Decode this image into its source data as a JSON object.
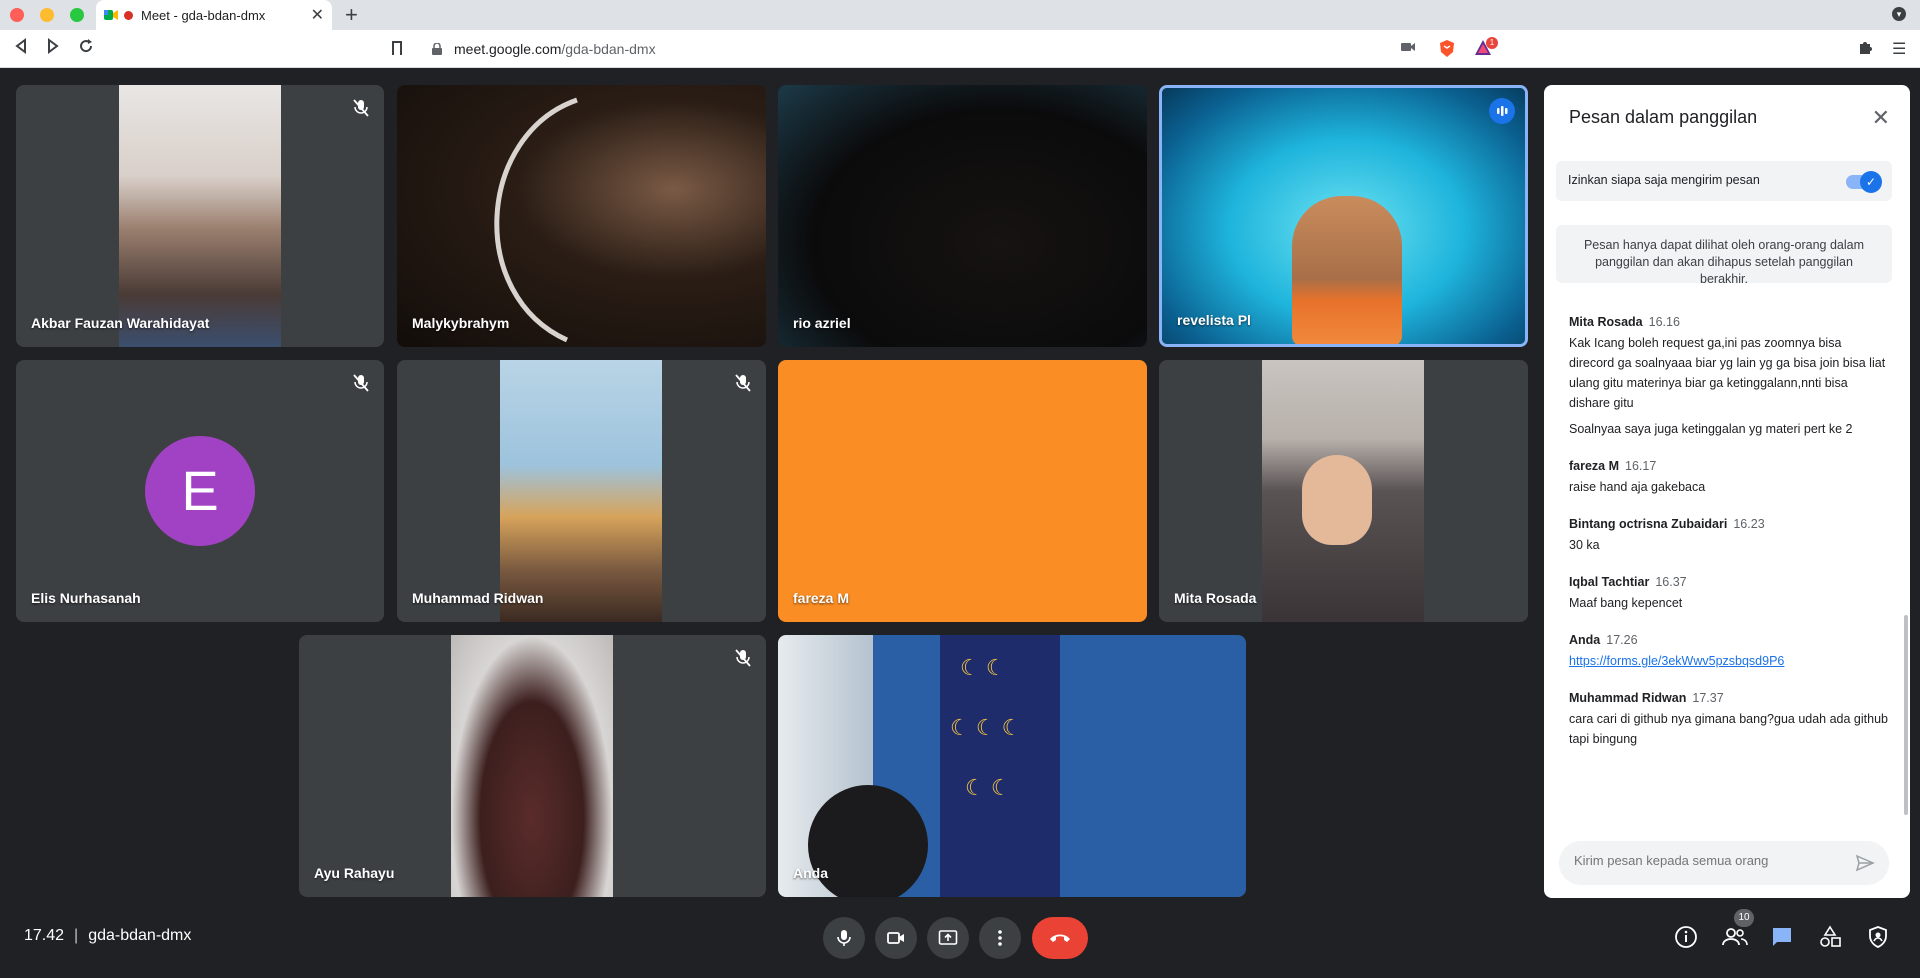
{
  "browser": {
    "tab_title": "Meet - gda-bdan-dmx",
    "url_host": "meet.google.com",
    "url_path": "/gda-bdan-dmx",
    "extension_badge": "1"
  },
  "tiles": [
    {
      "name": "Akbar Fauzan Warahidayat",
      "muted": true
    },
    {
      "name": "Malykybrahym",
      "muted": false
    },
    {
      "name": "rio azriel",
      "muted": false
    },
    {
      "name": "revelista Pl",
      "speaking": true
    },
    {
      "name": "Elis Nurhasanah",
      "muted": true,
      "avatar_letter": "E"
    },
    {
      "name": "Muhammad Ridwan",
      "muted": true
    },
    {
      "name": "fareza M",
      "muted": false
    },
    {
      "name": "Mita Rosada",
      "muted": false
    },
    {
      "name": "Ayu Rahayu",
      "muted": true
    },
    {
      "name": "Anda",
      "muted": false
    }
  ],
  "chat": {
    "title": "Pesan dalam panggilan",
    "toggle_label": "Izinkan siapa saja mengirim pesan",
    "toggle_on": true,
    "info": "Pesan hanya dapat dilihat oleh orang-orang dalam panggilan dan akan dihapus setelah panggilan berakhir.",
    "messages": [
      {
        "sender": "Mita Rosada",
        "time": "16.16",
        "lines": [
          "Kak Icang boleh request ga,ini pas zoomnya bisa direcord ga soalnyaaa biar yg lain yg ga bisa join bisa liat ulang gitu materinya biar ga ketinggalann,nnti bisa dishare gitu",
          "Soalnyaa saya juga ketinggalan yg materi pert ke 2"
        ]
      },
      {
        "sender": "fareza M",
        "time": "16.17",
        "lines": [
          "raise hand aja gakebaca"
        ]
      },
      {
        "sender": "Bintang octrisna Zubaidari",
        "time": "16.23",
        "lines": [
          "30 ka"
        ]
      },
      {
        "sender": "Iqbal Tachtiar",
        "time": "16.37",
        "lines": [
          "Maaf bang kepencet"
        ]
      },
      {
        "sender": "Anda",
        "time": "17.26",
        "link": "https://forms.gle/3ekWwv5pzsbqsd9P6"
      },
      {
        "sender": "Muhammad Ridwan",
        "time": "17.37",
        "lines": [
          "cara cari di github nya gimana bang?gua udah ada github tapi bingung"
        ]
      }
    ],
    "compose_placeholder": "Kirim pesan kepada semua orang"
  },
  "bottom": {
    "time": "17.42",
    "meeting_code": "gda-bdan-dmx",
    "people_count": "10"
  },
  "colors": {
    "background": "#202124",
    "tile": "#3c4043",
    "accent": "#1a73e8",
    "end_call": "#ea4335",
    "fareza_tile": "#fa8d23",
    "avatar": "#a142c4"
  }
}
